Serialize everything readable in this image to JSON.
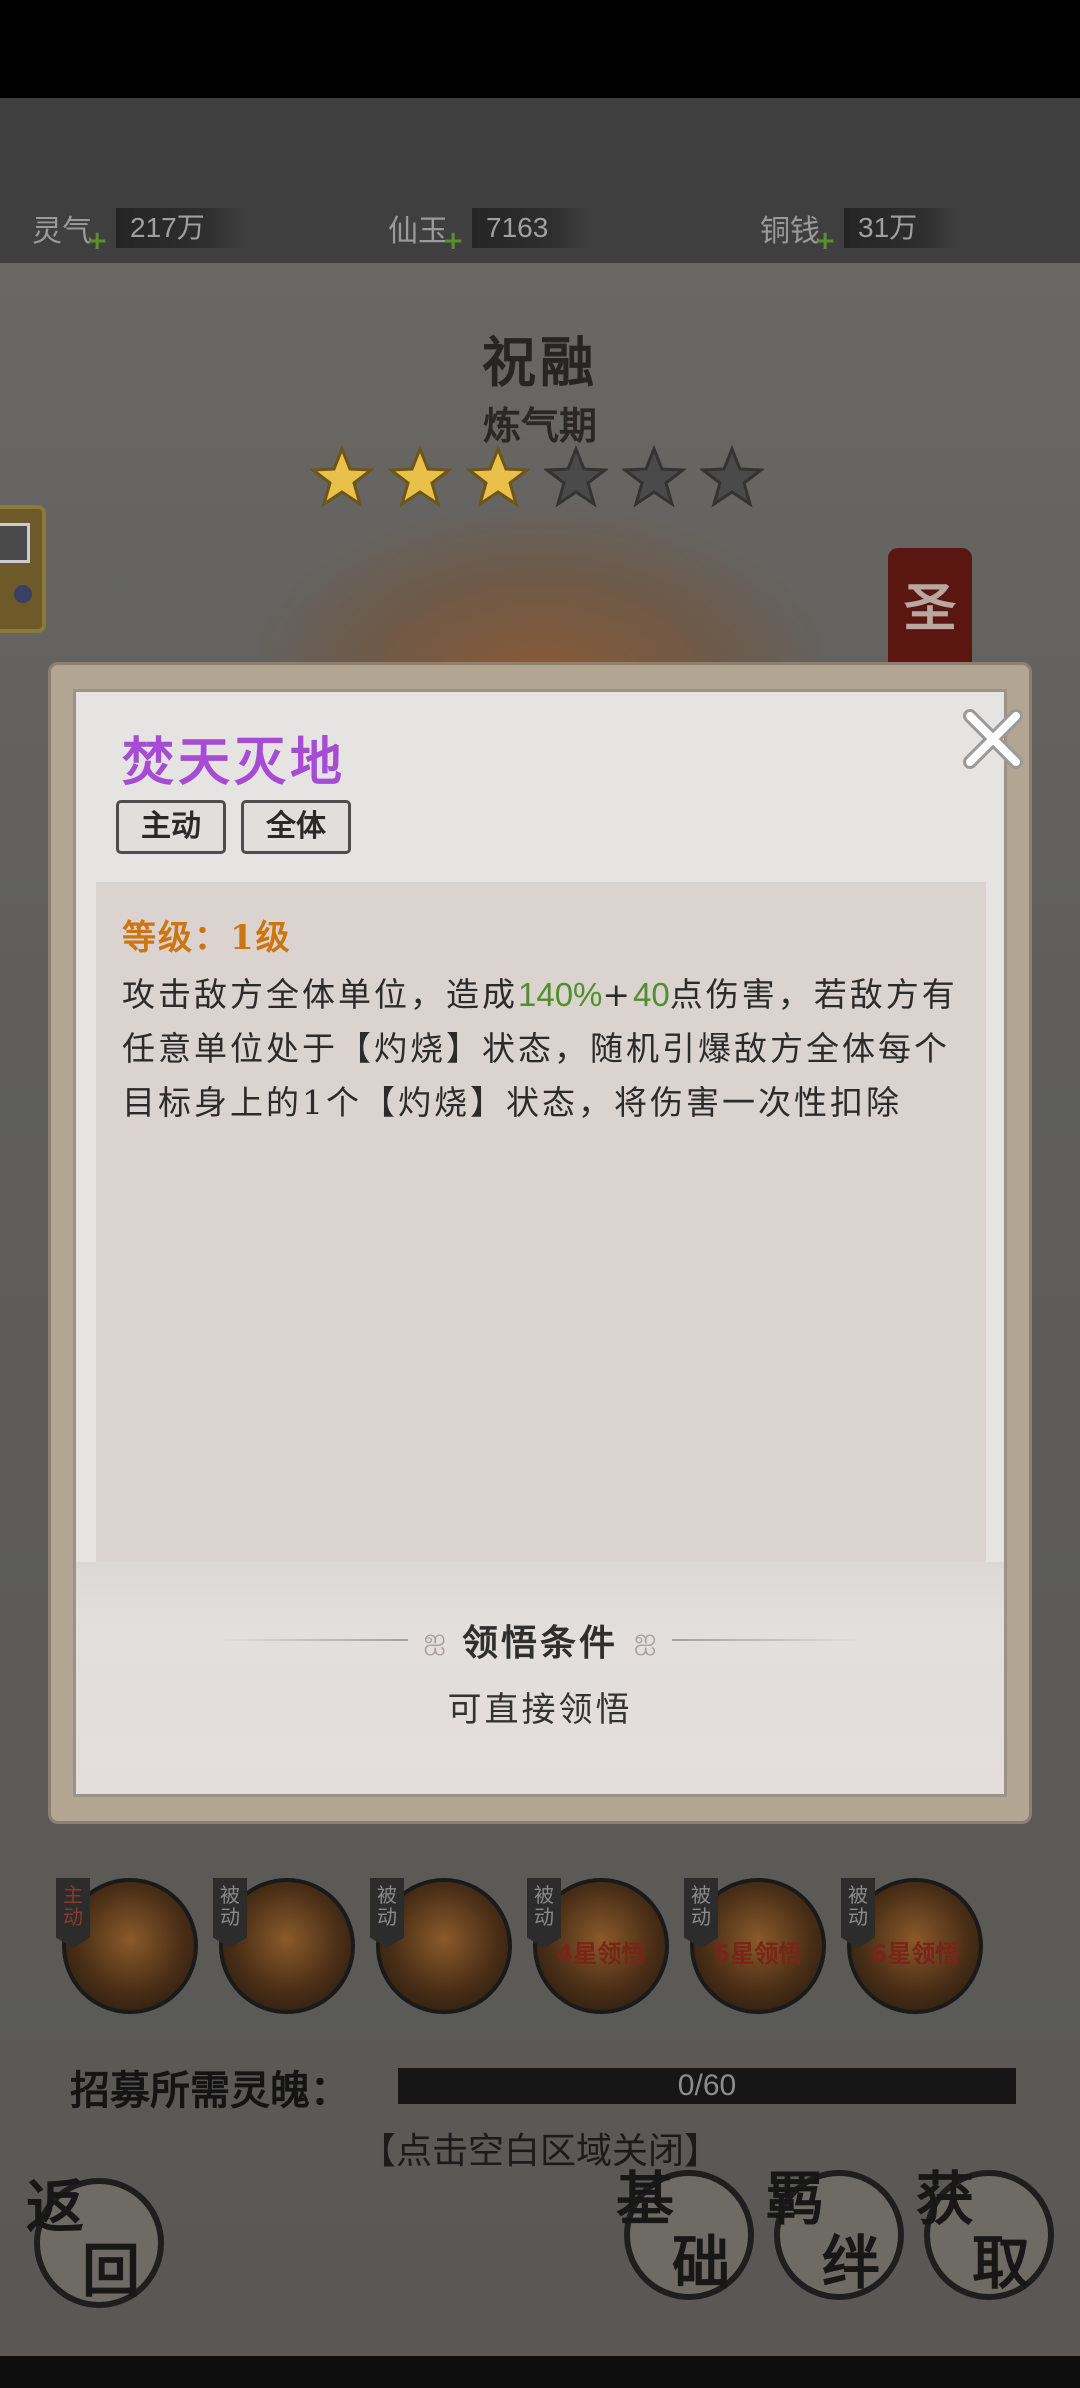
{
  "currencies": [
    {
      "label": "灵气",
      "value": "217万"
    },
    {
      "label": "仙玉",
      "value": "7163"
    },
    {
      "label": "铜钱",
      "value": "31万"
    }
  ],
  "hero": {
    "name": "祝融",
    "realm": "炼气期",
    "stars_filled": 3,
    "stars_total": 6
  },
  "banner_char": "圣",
  "modal": {
    "title": "焚天灭地",
    "tags": [
      "主动",
      "全体"
    ],
    "level": "等级：1级",
    "desc_parts": [
      "攻击敌方全体单位，造成",
      "140%",
      "+",
      "40",
      "点伤害，若敌方有任意单位处于【灼烧】状态，随机引爆敌方全体每个目标身上的1个【灼烧】状态，将伤害一次性扣除"
    ],
    "condition_title": "领悟条件",
    "condition_value": "可直接领悟"
  },
  "skills": [
    {
      "tag": "主动",
      "cond": ""
    },
    {
      "tag": "被动",
      "cond": ""
    },
    {
      "tag": "被动",
      "cond": ""
    },
    {
      "tag": "被动",
      "cond": "4星领悟"
    },
    {
      "tag": "被动",
      "cond": "5星领悟"
    },
    {
      "tag": "被动",
      "cond": "6星领悟"
    }
  ],
  "recruit": {
    "label": "招募所需灵魄：",
    "progress": "0/60",
    "fraction": 0
  },
  "close_hint": "【点击空白区域关闭】",
  "buttons": {
    "back": "返回",
    "basic": "基础",
    "bond": "羁绊",
    "obtain": "获取"
  },
  "colors": {
    "title_purple": "#a64bd4",
    "level_orange": "#cc7512",
    "highlight_green": "#4f8f2c",
    "star_gold": "#e8c04a"
  }
}
